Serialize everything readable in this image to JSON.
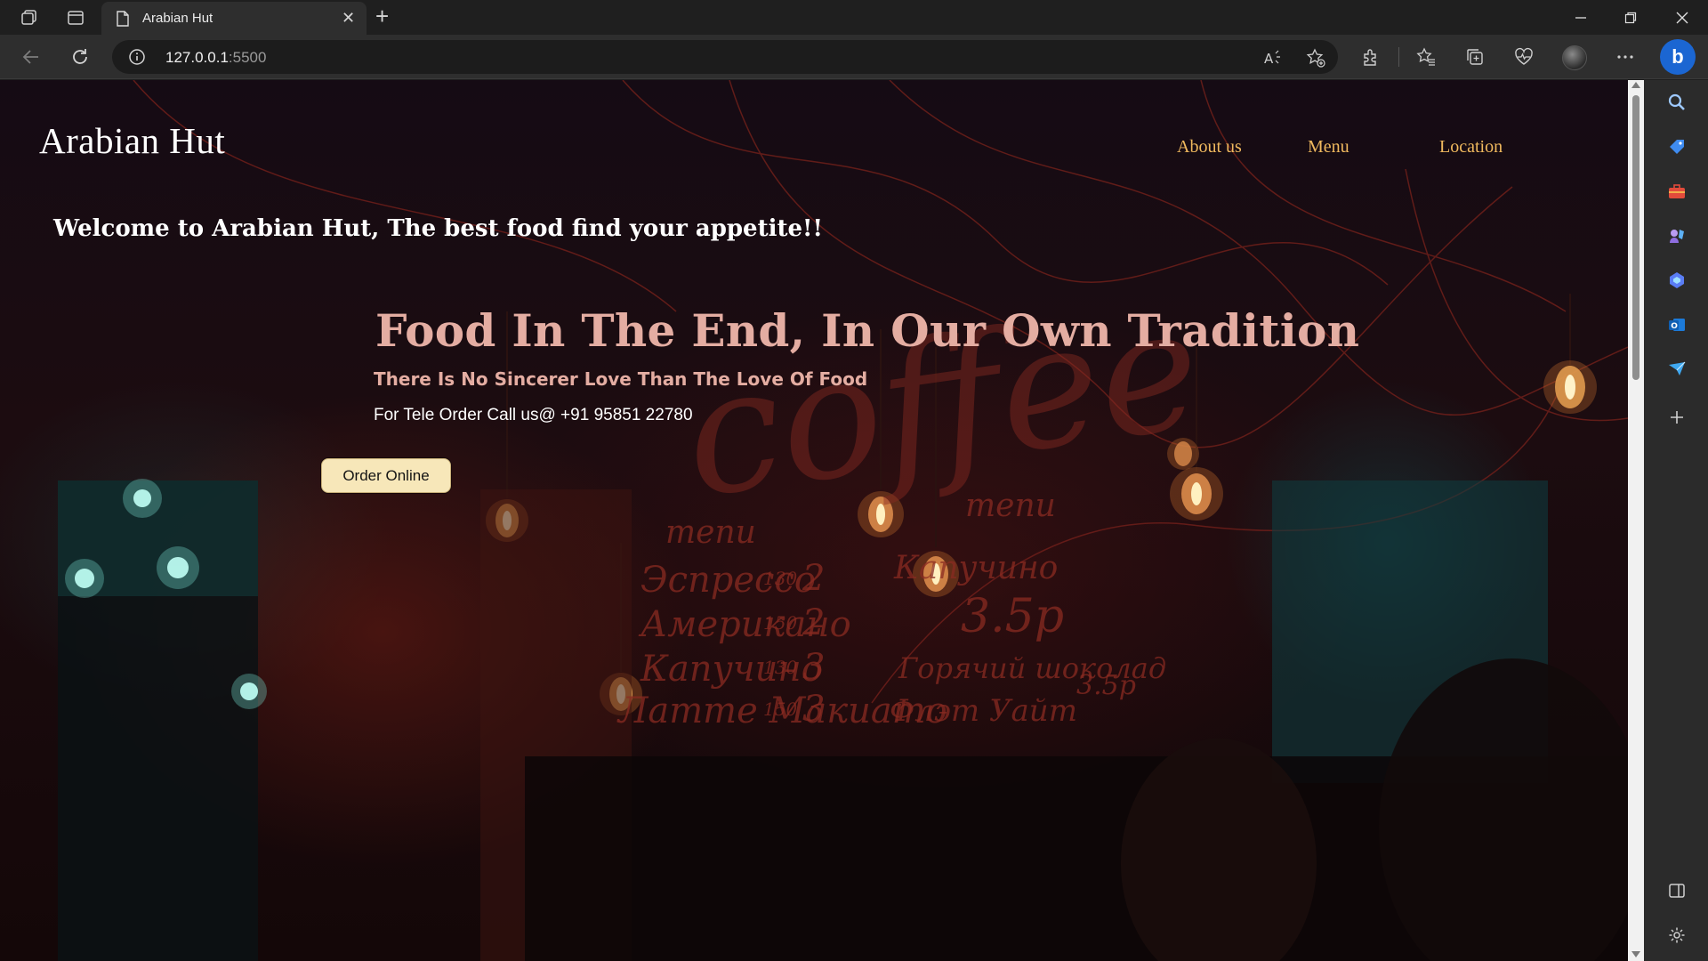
{
  "browser": {
    "tab": {
      "title": "Arabian Hut",
      "icon": "document-icon"
    },
    "address": {
      "host": "127.0.0.1",
      "port": ":5500"
    },
    "icons": {
      "workspaces": "workspaces-icon",
      "tab_actions": "tab-actions-icon",
      "new_tab": "+",
      "close_tab": "✕",
      "minimize": "minimize-icon",
      "restore": "restore-icon",
      "close_window": "close-icon",
      "back": "back-arrow-icon",
      "refresh": "refresh-icon",
      "info": "info-icon",
      "read_aloud": "read-aloud-icon",
      "add_favorite": "add-favorite-icon",
      "extensions": "extensions-icon",
      "favorites": "favorites-icon",
      "collections": "collections-icon",
      "health": "browser-essentials-icon",
      "more": "more-icon",
      "copilot": "b"
    },
    "sidebar_icons": [
      "search-icon",
      "shopping-tag-icon",
      "tools-briefcase-icon",
      "games-icon",
      "copilot-icon",
      "outlook-icon",
      "send-icon",
      "add-icon",
      "split-screen-icon",
      "settings-icon"
    ]
  },
  "site": {
    "logo": "Arabian Hut",
    "nav": [
      {
        "label": "About us"
      },
      {
        "label": "Menu"
      },
      {
        "label": "Location"
      }
    ],
    "welcome": "Welcome to Arabian Hut, The best food find your appetite!!",
    "hero": {
      "title": "Food In The End, In Our Own Tradition",
      "subtitle": "There Is No Sincerer Love Than The Love Of Food",
      "phone": "For Tele Order Call us@ +91 95851 22780",
      "cta": "Order Online"
    },
    "colors": {
      "nav_link": "#f0b95e",
      "hero_text": "#e4ada2",
      "button_bg": "#f7e7b9"
    },
    "background_signage": {
      "word": "coffee",
      "menu_label_1": "menu",
      "menu_label_2": "menu",
      "items_left": [
        "Эспрессо",
        "Американо",
        "Капучино",
        "Латте Макиато"
      ],
      "items_right": [
        "Капучино",
        "Горячий шоколад",
        "Флэт Уайт"
      ],
      "prices_left": [
        "130",
        "150",
        "130",
        "150"
      ],
      "values_left": [
        "2",
        "2",
        "3",
        "3"
      ],
      "values_right": [
        "3.5р",
        "3.5р"
      ]
    }
  }
}
